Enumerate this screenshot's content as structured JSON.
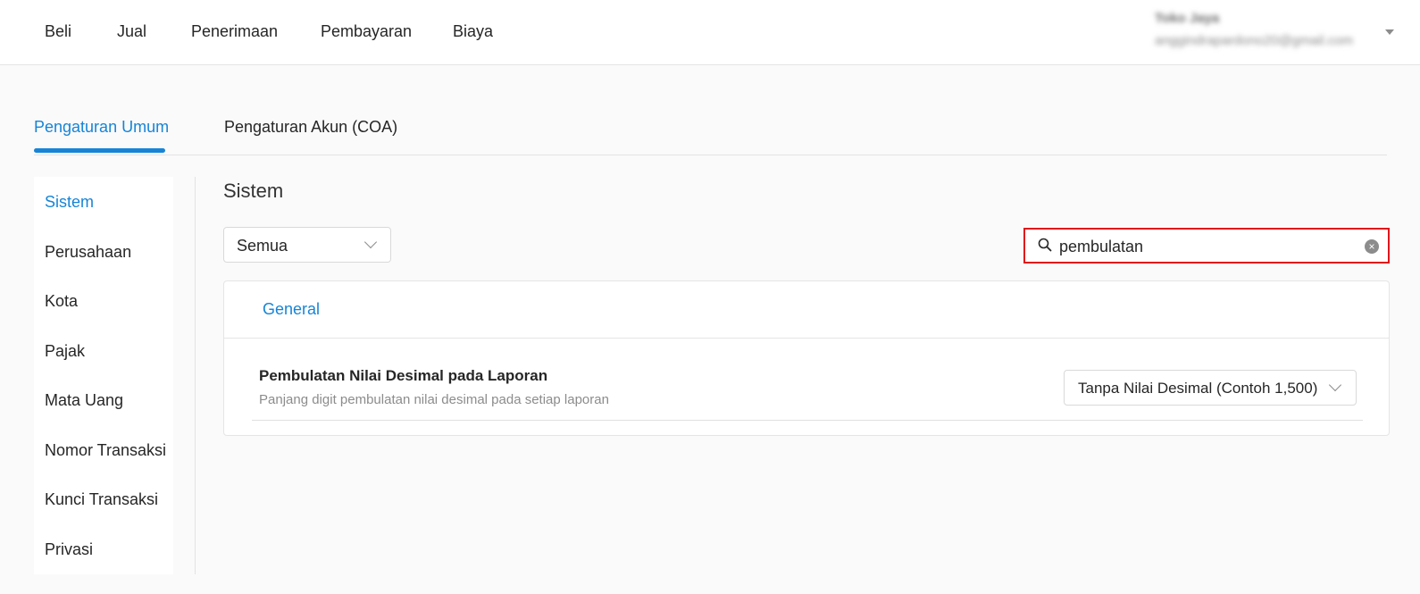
{
  "nav": {
    "items": [
      "Beli",
      "Jual",
      "Penerimaan",
      "Pembayaran",
      "Biaya"
    ]
  },
  "user": {
    "name": "Toko Jaya",
    "email": "anggindrapardono20@gmail.com"
  },
  "tabs": [
    {
      "label": "Pengaturan Umum",
      "active": true
    },
    {
      "label": "Pengaturan Akun (COA)",
      "active": false
    }
  ],
  "sidebar": {
    "items": [
      {
        "label": "Sistem",
        "active": true
      },
      {
        "label": "Perusahaan",
        "active": false
      },
      {
        "label": "Kota",
        "active": false
      },
      {
        "label": "Pajak",
        "active": false
      },
      {
        "label": "Mata Uang",
        "active": false
      },
      {
        "label": "Nomor Transaksi",
        "active": false
      },
      {
        "label": "Kunci Transaksi",
        "active": false
      },
      {
        "label": "Privasi",
        "active": false
      }
    ]
  },
  "main": {
    "title": "Sistem",
    "filter": {
      "value": "Semua"
    },
    "search": {
      "value": "pembulatan"
    },
    "card": {
      "header": "General",
      "setting": {
        "title": "Pembulatan Nilai Desimal pada Laporan",
        "description": "Panjang digit pembulatan nilai desimal pada setiap laporan",
        "value": "Tanpa Nilai Desimal (Contoh 1,500)"
      }
    }
  },
  "colors": {
    "accent": "#1784d6",
    "highlight_border": "#e0151b"
  }
}
